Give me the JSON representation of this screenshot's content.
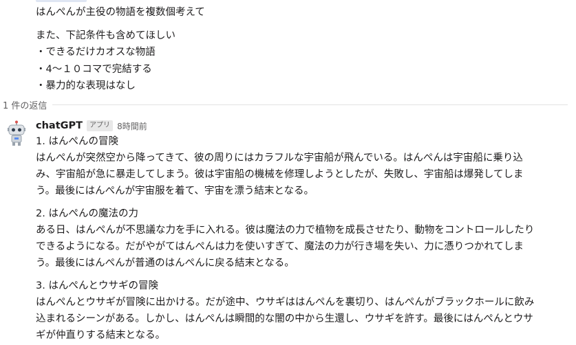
{
  "prompt": {
    "lines": [
      "はんぺんが主役の物語を複数個考えて",
      "また、下記条件も含めてほしい",
      "・できるだけカオスな物語",
      "・4〜１０コマで完結する",
      "・暴力的な表現はなし"
    ]
  },
  "thread": {
    "reply_count": "1 件の返信"
  },
  "reply": {
    "sender": "chatGPT",
    "badge": "アプリ",
    "time": "8時間前",
    "stories": [
      {
        "title": "1. はんぺんの冒険",
        "lines": [
          "はんぺんが突然空から降ってきて、彼の周りにはカラフルな宇宙船が飛んでいる。はんぺんは宇宙船に乗り込",
          "み、宇宙船が急に暴走してしまう。彼は宇宙船の機械を修理しようとしたが、失敗し、宇宙船は爆発してしま",
          "う。最後にはんぺんが宇宙服を着て、宇宙を漂う結末となる。"
        ]
      },
      {
        "title": "2. はんぺんの魔法の力",
        "lines": [
          "ある日、はんぺんが不思議な力を手に入れる。彼は魔法の力で植物を成長させたり、動物をコントロールしたり",
          "できるようになる。だがやがてはんぺんは力を使いすぎて、魔法の力が行き場を失い、力に憑りつかれてしま",
          "う。最後にはんぺんが普通のはんぺんに戻る結末となる。"
        ]
      },
      {
        "title": "3. はんぺんとウサギの冒険",
        "lines": [
          "はんぺんとウサギが冒険に出かける。だが途中、ウサギははんぺんを裏切り、はんぺんがブラックホールに飲み",
          "込まれるシーンがある。しかし、はんぺんは瞬間的な闇の中から生還し、ウサギを許す。最後にはんぺんとウサ",
          "ギが仲直りする結末となる。"
        ]
      }
    ]
  }
}
